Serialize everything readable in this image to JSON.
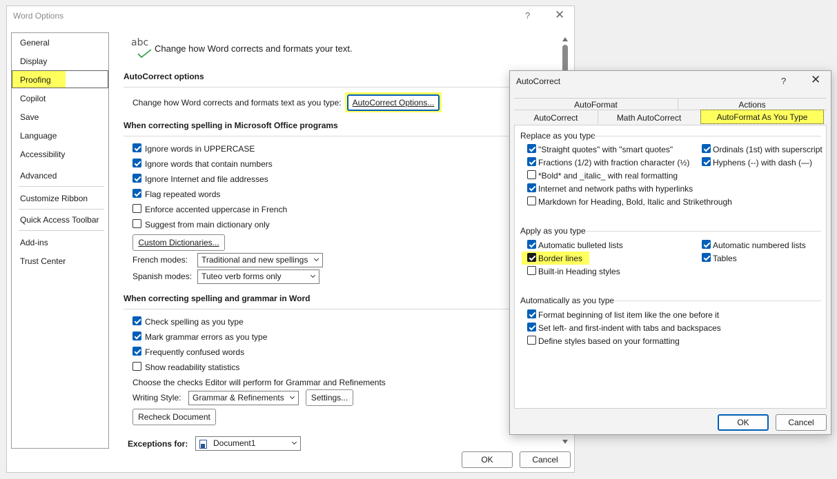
{
  "word_options": {
    "title": "Word Options",
    "help": "?",
    "close": "✕",
    "nav": [
      "General",
      "Display",
      "Proofing",
      "Copilot",
      "Save",
      "Language",
      "Accessibility",
      "Advanced",
      "Customize Ribbon",
      "Quick Access Toolbar",
      "Add-ins",
      "Trust Center"
    ],
    "selected_nav": "Proofing",
    "header_icon_text": "abc",
    "header_desc": "Change how Word corrects and formats your text.",
    "autocorrect_section": "AutoCorrect options",
    "autocorrect_desc": "Change how Word corrects and formats text as you type:",
    "autocorrect_button": "AutoCorrect Options...",
    "spelling_office_section": "When correcting spelling in Microsoft Office programs",
    "spelling_office_options": [
      {
        "label": "Ignore words in UPPERCASE",
        "checked": true
      },
      {
        "label": "Ignore words that contain numbers",
        "checked": true
      },
      {
        "label": "Ignore Internet and file addresses",
        "checked": true
      },
      {
        "label": "Flag repeated words",
        "checked": true
      },
      {
        "label": "Enforce accented uppercase in French",
        "checked": false
      },
      {
        "label": "Suggest from main dictionary only",
        "checked": false
      }
    ],
    "custom_dictionaries_button": "Custom Dictionaries...",
    "french_modes_label": "French modes:",
    "french_modes_value": "Traditional and new spellings",
    "spanish_modes_label": "Spanish modes:",
    "spanish_modes_value": "Tuteo verb forms only",
    "grammar_section": "When correcting spelling and grammar in Word",
    "grammar_options": [
      {
        "label": "Check spelling as you type",
        "checked": true
      },
      {
        "label": "Mark grammar errors as you type",
        "checked": true
      },
      {
        "label": "Frequently confused words",
        "checked": true
      },
      {
        "label": "Show readability statistics",
        "checked": false
      }
    ],
    "checks_desc": "Choose the checks Editor will perform for Grammar and Refinements",
    "writing_style_label": "Writing Style:",
    "writing_style_value": "Grammar & Refinements",
    "settings_button": "Settings...",
    "recheck_button": "Recheck Document",
    "exceptions_label": "Exceptions for:",
    "exceptions_value": "Document1",
    "ok": "OK",
    "cancel": "Cancel"
  },
  "autocorrect_dialog": {
    "title": "AutoCorrect",
    "help": "?",
    "close": "✕",
    "tabs_back": [
      "AutoFormat",
      "Actions"
    ],
    "tabs_front": [
      "AutoCorrect",
      "Math AutoCorrect",
      "AutoFormat As You Type"
    ],
    "active_tab": "AutoFormat As You Type",
    "replace_section": "Replace as you type",
    "replace_left": [
      {
        "label": "\"Straight quotes\" with \"smart quotes\"",
        "checked": true
      },
      {
        "label": "Fractions (1/2) with fraction character (½)",
        "checked": true
      },
      {
        "label": "*Bold* and _italic_ with real formatting",
        "checked": false
      },
      {
        "label": "Internet and network paths with hyperlinks",
        "checked": true
      },
      {
        "label": "Markdown for Heading, Bold, Italic and Strikethrough",
        "checked": false
      }
    ],
    "replace_right": [
      {
        "label": "Ordinals (1st) with superscript",
        "checked": true
      },
      {
        "label": "Hyphens (--) with dash (—)",
        "checked": true
      }
    ],
    "apply_section": "Apply as you type",
    "apply_left": [
      {
        "label": "Automatic bulleted lists",
        "checked": true
      },
      {
        "label": "Border lines",
        "checked": true
      },
      {
        "label": "Built-in Heading styles",
        "checked": false
      }
    ],
    "apply_right": [
      {
        "label": "Automatic numbered lists",
        "checked": true
      },
      {
        "label": "Tables",
        "checked": true
      }
    ],
    "auto_section": "Automatically as you type",
    "auto_options": [
      {
        "label": "Format beginning of list item like the one before it",
        "checked": true
      },
      {
        "label": "Set left- and first-indent with tabs and backspaces",
        "checked": true
      },
      {
        "label": "Define styles based on your formatting",
        "checked": false
      }
    ],
    "ok": "OK",
    "cancel": "Cancel"
  },
  "colors": {
    "highlight": "#ffff5e",
    "accent": "#005fb8"
  }
}
